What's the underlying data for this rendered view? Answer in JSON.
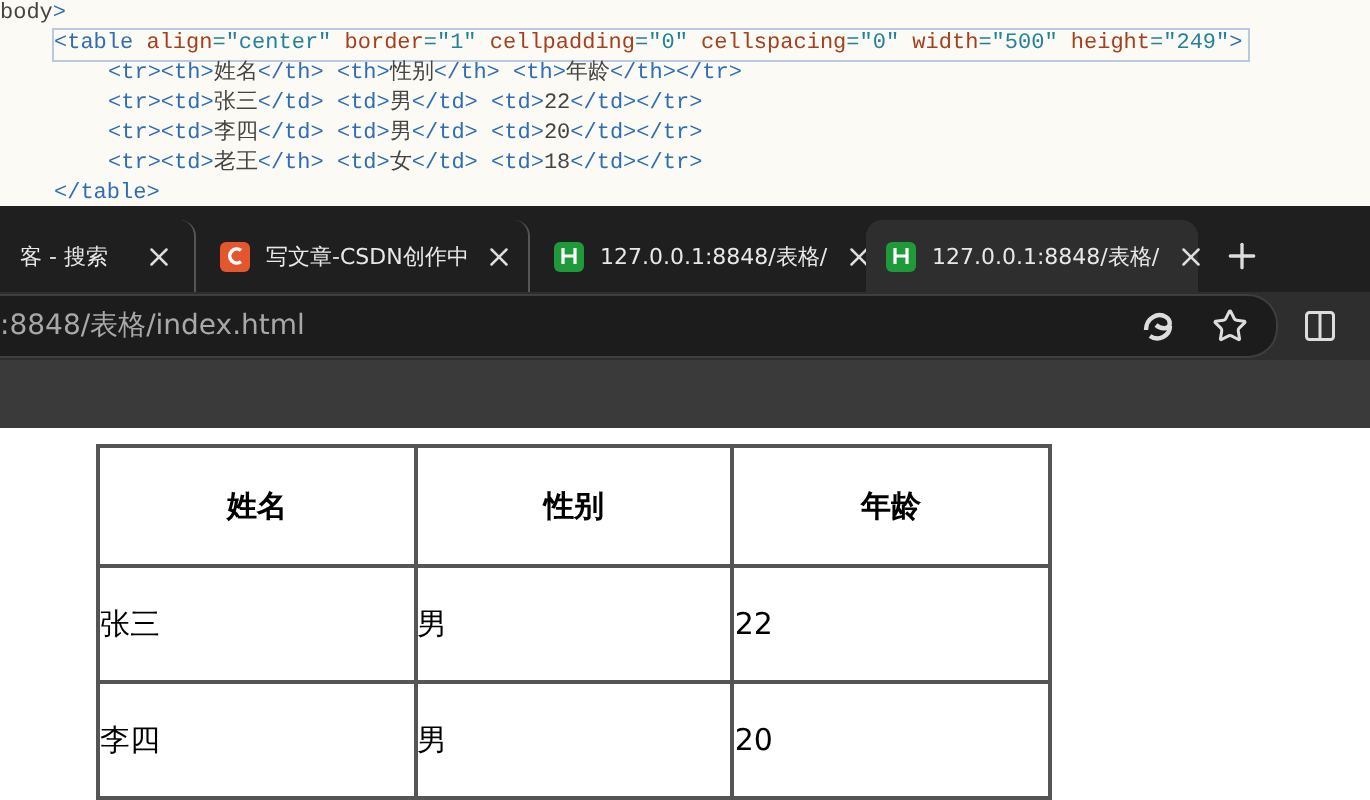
{
  "editor": {
    "lines": [
      {
        "text": "body>",
        "current": false,
        "children": [
          {
            "text": "<table align=\"center\" border=\"1\" cellpadding=\"0\" cellspacing=\"0\" width=\"500\" height=\"249\">",
            "current": true,
            "children": [
              {
                "text": "<tr><th>姓名</th> <th>性别</th> <th>年龄</th></tr>",
                "current": false
              },
              {
                "text": "<tr><td>张三</td> <td>男</td> <td>22</td></tr>",
                "current": false
              },
              {
                "text": "<tr><td>李四</td> <td>男</td> <td>20</td></tr>",
                "current": false
              },
              {
                "text": "<tr><td>老王</th> <td>女</td> <td>18</td></tr>",
                "current": false
              }
            ]
          },
          {
            "text": "</table>",
            "current": false
          }
        ]
      }
    ]
  },
  "browser": {
    "tabs": [
      {
        "title": "客 - 搜索",
        "kind": "none",
        "selected": false
      },
      {
        "title": "写文章-CSDN创作中",
        "kind": "c",
        "selected": false
      },
      {
        "title": "127.0.0.1:8848/表格/",
        "kind": "h",
        "selected": false
      },
      {
        "title": "127.0.0.1:8848/表格/",
        "kind": "h",
        "selected": true
      }
    ],
    "address": ":8848/表格/index.html"
  },
  "table": {
    "columns": [
      "姓名",
      "性别",
      "年龄"
    ],
    "rows": [
      [
        "张三",
        "男",
        "22"
      ],
      [
        "李四",
        "男",
        "20"
      ]
    ]
  }
}
